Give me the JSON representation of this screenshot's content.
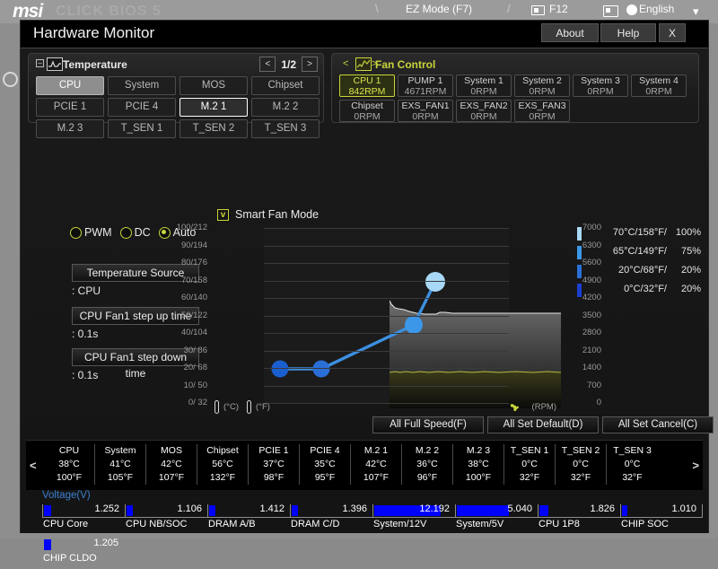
{
  "bios": {
    "logo": "msi",
    "model": "CLICK BIOS 5",
    "ez_mode": "EZ Mode (F7)",
    "screenshot_key": "F12",
    "language": "English"
  },
  "window": {
    "title": "Hardware Monitor",
    "about": "About",
    "help": "Help",
    "close": "X"
  },
  "temperature_panel": {
    "header": "Temperature",
    "page": "1/2",
    "prev": "<",
    "next": ">",
    "sensors": [
      {
        "label": "CPU",
        "state": "active"
      },
      {
        "label": "System",
        "state": "normal"
      },
      {
        "label": "MOS",
        "state": "normal"
      },
      {
        "label": "Chipset",
        "state": "normal"
      },
      {
        "label": "PCIE 1",
        "state": "normal"
      },
      {
        "label": "PCIE 4",
        "state": "normal"
      },
      {
        "label": "M.2 1",
        "state": "selected"
      },
      {
        "label": "M.2 2",
        "state": "normal"
      },
      {
        "label": "M.2 3",
        "state": "normal"
      },
      {
        "label": "T_SEN 1",
        "state": "normal"
      },
      {
        "label": "T_SEN 2",
        "state": "normal"
      },
      {
        "label": "T_SEN 3",
        "state": "normal"
      }
    ]
  },
  "fan_panel": {
    "header": "Fan Control",
    "prev": "<",
    "next": ">",
    "accent": "#c8d43a",
    "fans": [
      {
        "name": "CPU 1",
        "rpm": "842RPM",
        "state": "active"
      },
      {
        "name": "PUMP 1",
        "rpm": "4671RPM",
        "state": "normal"
      },
      {
        "name": "System 1",
        "rpm": "0RPM",
        "state": "normal"
      },
      {
        "name": "System 2",
        "rpm": "0RPM",
        "state": "normal"
      },
      {
        "name": "System 3",
        "rpm": "0RPM",
        "state": "normal"
      },
      {
        "name": "System 4",
        "rpm": "0RPM",
        "state": "normal"
      },
      {
        "name": "Chipset",
        "rpm": "0RPM",
        "state": "normal"
      },
      {
        "name": "EXS_FAN1",
        "rpm": "0RPM",
        "state": "normal"
      },
      {
        "name": "EXS_FAN2",
        "rpm": "0RPM",
        "state": "normal"
      },
      {
        "name": "EXS_FAN3",
        "rpm": "0RPM",
        "state": "normal"
      }
    ]
  },
  "controls": {
    "modes": [
      {
        "label": "PWM",
        "selected": false
      },
      {
        "label": "DC",
        "selected": false
      },
      {
        "label": "Auto",
        "selected": true
      }
    ],
    "temperature_source_label": "Temperature Source",
    "temperature_source_value": ": CPU",
    "step_up_label": "CPU Fan1 step up time",
    "step_up_value": ": 0.1s",
    "step_down_label": "CPU Fan1 step down time",
    "step_down_value": ": 0.1s",
    "smart_fan_mode_label": "Smart Fan Mode",
    "smart_fan_mode_checked": true,
    "checkmark": "v"
  },
  "chart_data": {
    "type": "line",
    "title": "Smart Fan Mode",
    "xlabel": "",
    "ylabel": "",
    "y_left_ticks": [
      "100/212",
      "90/194",
      "80/176",
      "70/158",
      "60/140",
      "50/122",
      "40/104",
      "30/ 86",
      "20/ 68",
      "10/ 50",
      "0/ 32"
    ],
    "y_right_ticks": [
      "7000",
      "6300",
      "5600",
      "4900",
      "4200",
      "3500",
      "2800",
      "2100",
      "1400",
      "700",
      "0"
    ],
    "ylim_celsius": [
      0,
      100
    ],
    "ylim_rpm": [
      0,
      7000
    ],
    "grid": true,
    "foot_celsius": "(°C)",
    "foot_fahrenheit": "(°F)",
    "foot_rpm": "(RPM)",
    "curve_points": [
      {
        "temp_c": 0,
        "temp_f": 32,
        "duty_pct": 20,
        "color": "#1a5fd0"
      },
      {
        "temp_c": 20,
        "temp_f": 68,
        "duty_pct": 20,
        "color": "#2a6fd8"
      },
      {
        "temp_c": 65,
        "temp_f": 149,
        "duty_pct": 75,
        "color": "#3c97e8"
      },
      {
        "temp_c": 70,
        "temp_f": 158,
        "duty_pct": 100,
        "color": "#a8d8f5"
      }
    ],
    "legend": [
      {
        "temp": "70°C/158°F/",
        "pct": "100%",
        "color": "#a8d8f5"
      },
      {
        "temp": "65°C/149°F/",
        "pct": "75%",
        "color": "#3c97e8"
      },
      {
        "temp": "20°C/68°F/",
        "pct": "20%",
        "color": "#2a6fd8"
      },
      {
        "temp": "0°C/32°F/",
        "pct": "20%",
        "color": "#1a3fd0"
      }
    ],
    "history_temp_trace_note": "white line ~ 38-45°C",
    "history_rpm_trace_note": "yellow line ~ 800RPM"
  },
  "actions": [
    {
      "label": "All Full Speed(F)"
    },
    {
      "label": "All Set Default(D)"
    },
    {
      "label": "All Set Cancel(C)"
    }
  ],
  "temp_strip": {
    "prev": "<",
    "next": ">",
    "cells": [
      {
        "name": "CPU",
        "c": "38°C",
        "f": "100°F"
      },
      {
        "name": "System",
        "c": "41°C",
        "f": "105°F"
      },
      {
        "name": "MOS",
        "c": "42°C",
        "f": "107°F"
      },
      {
        "name": "Chipset",
        "c": "56°C",
        "f": "132°F"
      },
      {
        "name": "PCIE 1",
        "c": "37°C",
        "f": "98°F"
      },
      {
        "name": "PCIE 4",
        "c": "35°C",
        "f": "95°F"
      },
      {
        "name": "M.2 1",
        "c": "42°C",
        "f": "107°F"
      },
      {
        "name": "M.2 2",
        "c": "36°C",
        "f": "96°F"
      },
      {
        "name": "M.2 3",
        "c": "38°C",
        "f": "100°F"
      },
      {
        "name": "T_SEN 1",
        "c": "0°C",
        "f": "32°F"
      },
      {
        "name": "T_SEN 2",
        "c": "0°C",
        "f": "32°F"
      },
      {
        "name": "T_SEN 3",
        "c": "0°C",
        "f": "32°F"
      }
    ]
  },
  "voltage": {
    "title": "Voltage(V)",
    "items": [
      {
        "name": "CPU Core",
        "value": "1.252",
        "fill_pct": 10
      },
      {
        "name": "CPU NB/SOC",
        "value": "1.106",
        "fill_pct": 9
      },
      {
        "name": "DRAM A/B",
        "value": "1.412",
        "fill_pct": 9
      },
      {
        "name": "DRAM C/D",
        "value": "1.396",
        "fill_pct": 9
      },
      {
        "name": "System/12V",
        "value": "12.192",
        "fill_pct": 92
      },
      {
        "name": "System/5V",
        "value": "5.040",
        "fill_pct": 72
      },
      {
        "name": "CPU 1P8",
        "value": "1.826",
        "fill_pct": 13
      },
      {
        "name": "CHIP SOC",
        "value": "1.010",
        "fill_pct": 8
      },
      {
        "name": "CHIP CLDO",
        "value": "1.205",
        "fill_pct": 10
      }
    ]
  }
}
